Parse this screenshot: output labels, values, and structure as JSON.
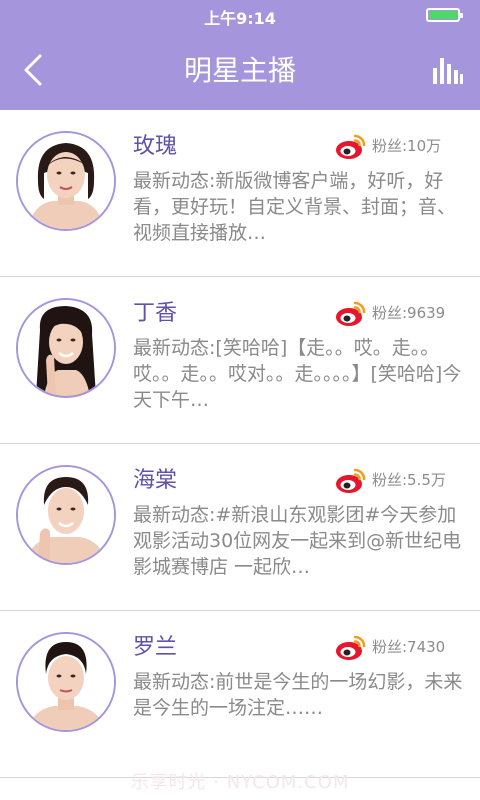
{
  "status_bar": {
    "time": "上午9:14"
  },
  "nav": {
    "title": "明星主播",
    "back_icon": "chevron-left-icon",
    "chart_icon": "bar-chart-icon"
  },
  "colors": {
    "header": "#a595dc",
    "name": "#5f52a8",
    "weibo_red": "#e6162d",
    "weibo_orange": "#f29c1f"
  },
  "anchors": [
    {
      "name": "玫瑰",
      "fans": "粉丝:10万",
      "status": "最新动态:新版微博客户端，好听，好看，更好玩！自定义背景、封面；音、视频直接播放…"
    },
    {
      "name": "丁香",
      "fans": "粉丝:9639",
      "status": "最新动态:[笑哈哈]【走。。哎。走。。哎。。走。。哎对。。走。。。。】[笑哈哈]今天下午…"
    },
    {
      "name": "海棠",
      "fans": "粉丝:5.5万",
      "status": "最新动态:#新浪山东观影团#今天参加观影活动30位网友一起来到@新世纪电影城赛博店 一起欣…"
    },
    {
      "name": "罗兰",
      "fans": "粉丝:7430",
      "status": "最新动态:前世是今生的一场幻影，未来是今生的一场注定……"
    }
  ],
  "watermark": "乐享时光 · NYCOM.COM"
}
